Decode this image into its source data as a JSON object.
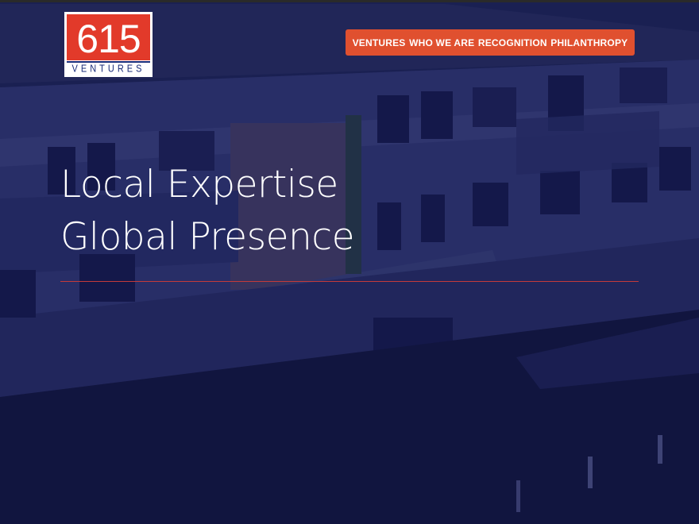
{
  "logo": {
    "number": "615",
    "word": "VENTURES"
  },
  "nav": {
    "items": [
      {
        "label": "VENTURES"
      },
      {
        "label": "WHO WE ARE"
      },
      {
        "label": "RECOGNITION"
      },
      {
        "label": "PHILANTHROPY"
      }
    ]
  },
  "hero": {
    "line1": "Local Expertise",
    "line2": "Global Presence"
  },
  "colors": {
    "nav_background": "#e0502f",
    "logo_red": "#e23a2a",
    "logo_blue": "#1a2d7a",
    "overlay_navy": "#141a3a",
    "rule_red": "#c43a3a"
  }
}
